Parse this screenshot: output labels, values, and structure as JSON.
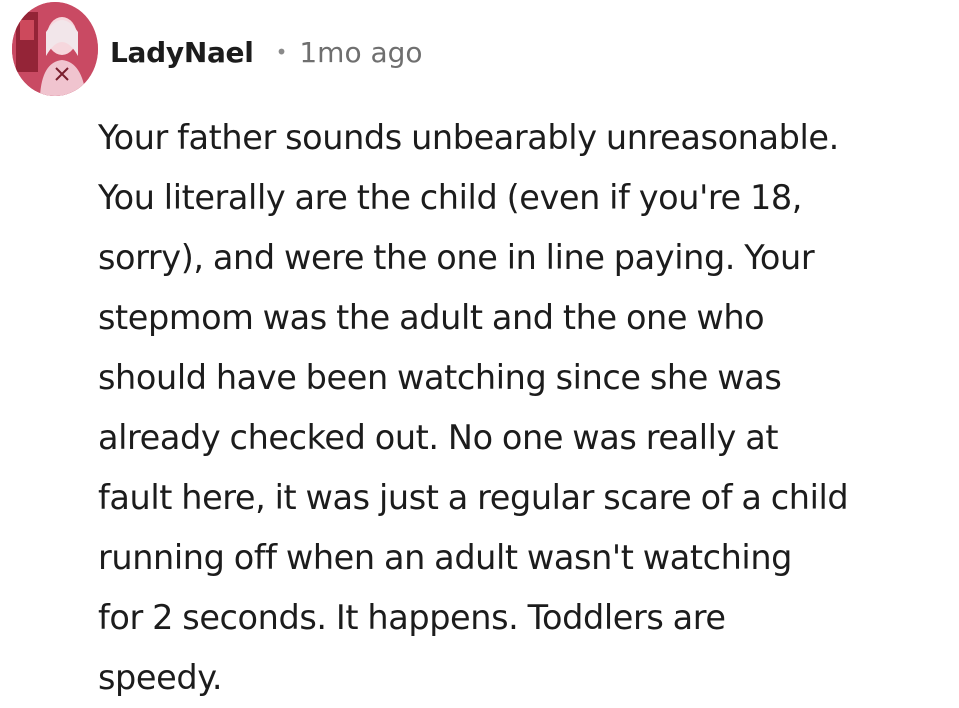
{
  "comment": {
    "author": "LadyNael",
    "separator": "•",
    "timestamp": "1mo ago",
    "lines": [
      "Your father sounds unbearably unreasonable.",
      "You literally are the child (even if you're 18,",
      "sorry), and were the one in line paying. Your",
      "stepmom was the adult and the one who",
      "should have been watching since she was",
      "already checked out. No one was really at",
      "fault here, it was just a regular scare of a child",
      "running off when an adult wasn't watching",
      "for 2 seconds. It happens. Toddlers are",
      "speedy."
    ]
  },
  "icons": {
    "avatar": "user-avatar"
  },
  "colors": {
    "text": "#1c1c1c",
    "meta": "#6f6f6f",
    "avatar_accent": "#c2455e"
  }
}
